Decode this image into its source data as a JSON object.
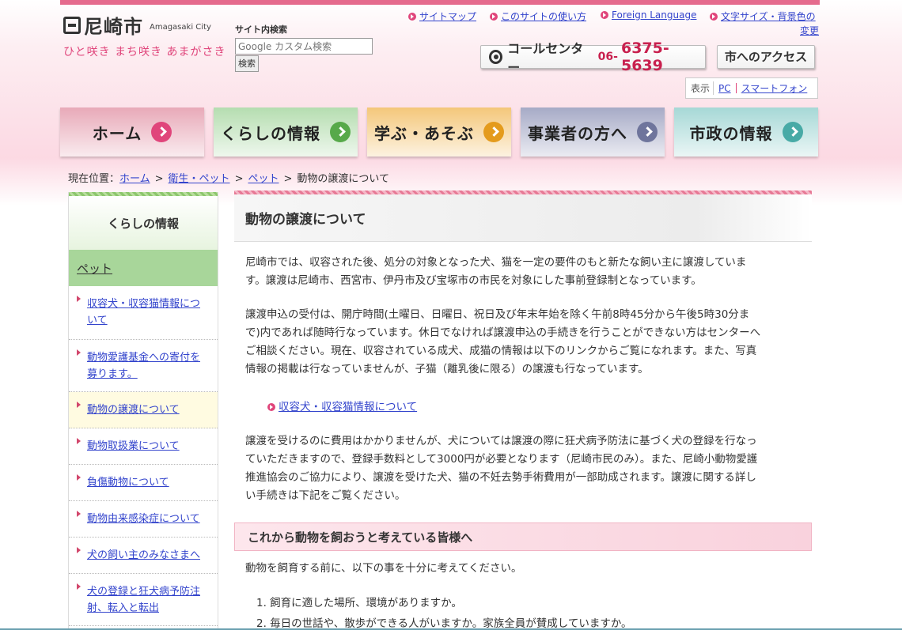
{
  "header": {
    "logo_title": "尼崎市",
    "logo_en": "Amagasaki City",
    "catchphrase": "ひと咲き まち咲き あまがさき",
    "search_label": "サイト内検索",
    "search_placeholder": "Google カスタム検索",
    "search_button": "検索",
    "util_links": [
      "サイトマップ",
      "このサイトの使い方",
      "Foreign Language",
      "文字サイズ・背景色の",
      "変更"
    ],
    "call_center_label": "コールセンター",
    "call_center_prefix": "06-",
    "call_center_number": "6375-5639",
    "access_button": "市へのアクセス",
    "display_label": "表示",
    "display_pc": "PC",
    "display_smartphone": "スマートフォン"
  },
  "nav": {
    "items": [
      {
        "label": "ホーム",
        "color": "#e8a9b8",
        "arrow": "#e0457b"
      },
      {
        "label": "くらしの情報",
        "color": "#b5ddb0",
        "arrow": "#57a94a"
      },
      {
        "label": "学ぶ・あそぶ",
        "color": "#f4c77a",
        "arrow": "#e49b1c"
      },
      {
        "label": "事業者の方へ",
        "color": "#a6aac6",
        "arrow": "#6f759c"
      },
      {
        "label": "市政の情報",
        "color": "#a6d8d6",
        "arrow": "#48aaa6"
      }
    ]
  },
  "breadcrumb": {
    "prefix": "現在位置：",
    "items": [
      "ホーム",
      "衛生・ペット",
      "ペット"
    ],
    "current": "動物の譲渡について"
  },
  "sidebar": {
    "title": "くらしの情報",
    "category": "ペット",
    "items": [
      {
        "line1": "収容犬・収容猫情報につ",
        "line2": "いて"
      },
      {
        "line1": "動物愛護基金への寄付を",
        "line2": "募ります。"
      },
      {
        "line1": "動物の譲渡について",
        "line2": ""
      },
      {
        "line1": "動物取扱業について",
        "line2": ""
      },
      {
        "line1": "負傷動物について",
        "line2": ""
      },
      {
        "line1": "動物由来感染症について",
        "line2": ""
      },
      {
        "line1": "犬の飼い主のみなさまへ",
        "line2": ""
      },
      {
        "line1": "犬の登録と狂犬病予防注",
        "line2": "射、転入と転出"
      }
    ]
  },
  "main": {
    "heading": "動物の譲渡について",
    "p1": [
      "尼崎市では、収容された後、処分の対象となった犬、猫を一定の要件のもと新たな飼い主に譲渡していま",
      "す。譲渡は尼崎市、西宮市、伊丹市及び宝塚市の市民を対象にした事前登録制となっています。"
    ],
    "p2": [
      "譲渡申込の受付は、開庁時間(土曜日、日曜日、祝日及び年末年始を除く午前8時45分から午後5時30分ま",
      "で)内であれば随時行なっています。休日でなければ譲渡申込の手続きを行うことができない方はセンターへ",
      "ご相談ください。現在、収容されている成犬、成猫の情報は以下のリンクからご覧になれます。また、写真",
      "情報の掲載は行なっていませんが、子猫（離乳後に限る）の譲渡も行なっています。"
    ],
    "link": "収容犬・収容猫情報について",
    "p3": [
      "譲渡を受けるのに費用はかかりませんが、犬については譲渡の際に狂犬病予防法に基づく犬の登録を行なっ",
      "ていただきますので、登録手数料として3000円が必要となります（尼崎市民のみ）。また、尼崎小動物愛護",
      "推進協会のご協力により、譲渡を受けた犬、猫の不妊去勢手術費用が一部助成されます。譲渡に関する詳し",
      "い手続きは下記をご覧ください。"
    ],
    "subheading": "これから動物を飼おうと考えている皆様へ",
    "intro": "動物を飼育する前に、以下の事を十分に考えてください。",
    "list": [
      "1. 飼育に適した場所、環境がありますか。",
      "2. 毎日の世話や、散歩ができる人がいますか。家族全員が賛成していますか。"
    ]
  }
}
